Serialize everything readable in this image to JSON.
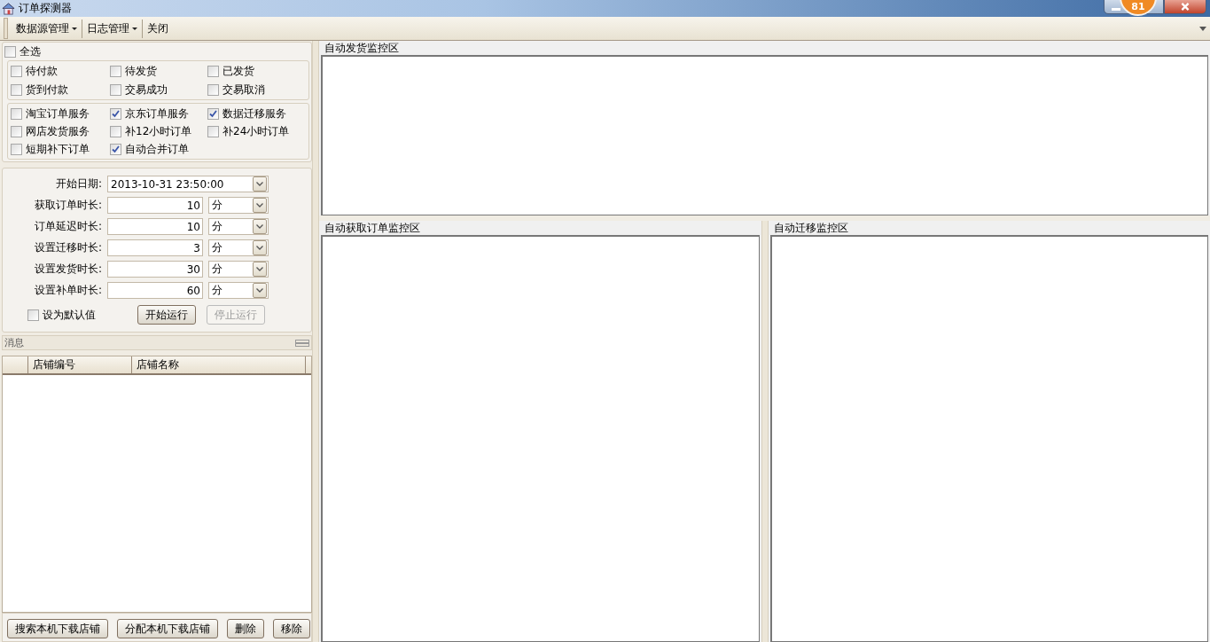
{
  "window": {
    "title": "订单探测器",
    "badge": "81"
  },
  "menu": [
    {
      "label": "数据源管理",
      "dropdown": true
    },
    {
      "label": "日志管理",
      "dropdown": true
    },
    {
      "label": "关闭",
      "dropdown": false
    }
  ],
  "select_all": {
    "label": "全选",
    "checked": false
  },
  "status_filters": [
    {
      "label": "待付款",
      "checked": false
    },
    {
      "label": "待发货",
      "checked": false
    },
    {
      "label": "已发货",
      "checked": false
    },
    {
      "label": "货到付款",
      "checked": false
    },
    {
      "label": "交易成功",
      "checked": false
    },
    {
      "label": "交易取消",
      "checked": false
    }
  ],
  "services": [
    {
      "label": "淘宝订单服务",
      "checked": false
    },
    {
      "label": "京东订单服务",
      "checked": true
    },
    {
      "label": "数据迁移服务",
      "checked": true
    },
    {
      "label": "网店发货服务",
      "checked": false
    },
    {
      "label": "补12小时订单",
      "checked": false
    },
    {
      "label": "补24小时订单",
      "checked": false
    },
    {
      "label": "短期补下订单",
      "checked": false
    },
    {
      "label": "自动合并订单",
      "checked": true
    }
  ],
  "settings": [
    {
      "label": "开始日期:",
      "value": "2013-10-31 23:50:00",
      "kind": "date"
    },
    {
      "label": "获取订单时长:",
      "value": "10",
      "unit": "分",
      "kind": "duration"
    },
    {
      "label": "订单延迟时长:",
      "value": "10",
      "unit": "分",
      "kind": "duration"
    },
    {
      "label": "设置迁移时长:",
      "value": "3",
      "unit": "分",
      "kind": "duration"
    },
    {
      "label": "设置发货时长:",
      "value": "30",
      "unit": "分",
      "kind": "duration"
    },
    {
      "label": "设置补单时长:",
      "value": "60",
      "unit": "分",
      "kind": "duration"
    }
  ],
  "set_default": {
    "label": "设为默认值",
    "checked": false
  },
  "run_buttons": [
    {
      "label": "开始运行",
      "disabled": false
    },
    {
      "label": "停止运行",
      "disabled": true
    }
  ],
  "message_bar": {
    "label": "消息"
  },
  "shop_table": {
    "columns": [
      "店铺编号",
      "店铺名称"
    ]
  },
  "shop_buttons": [
    {
      "label": "搜索本机下载店铺"
    },
    {
      "label": "分配本机下载店铺"
    },
    {
      "label": "删除"
    },
    {
      "label": "移除"
    }
  ],
  "monitors": [
    {
      "title": "自动发货监控区"
    },
    {
      "title": "自动获取订单监控区"
    },
    {
      "title": "自动迁移监控区"
    }
  ]
}
